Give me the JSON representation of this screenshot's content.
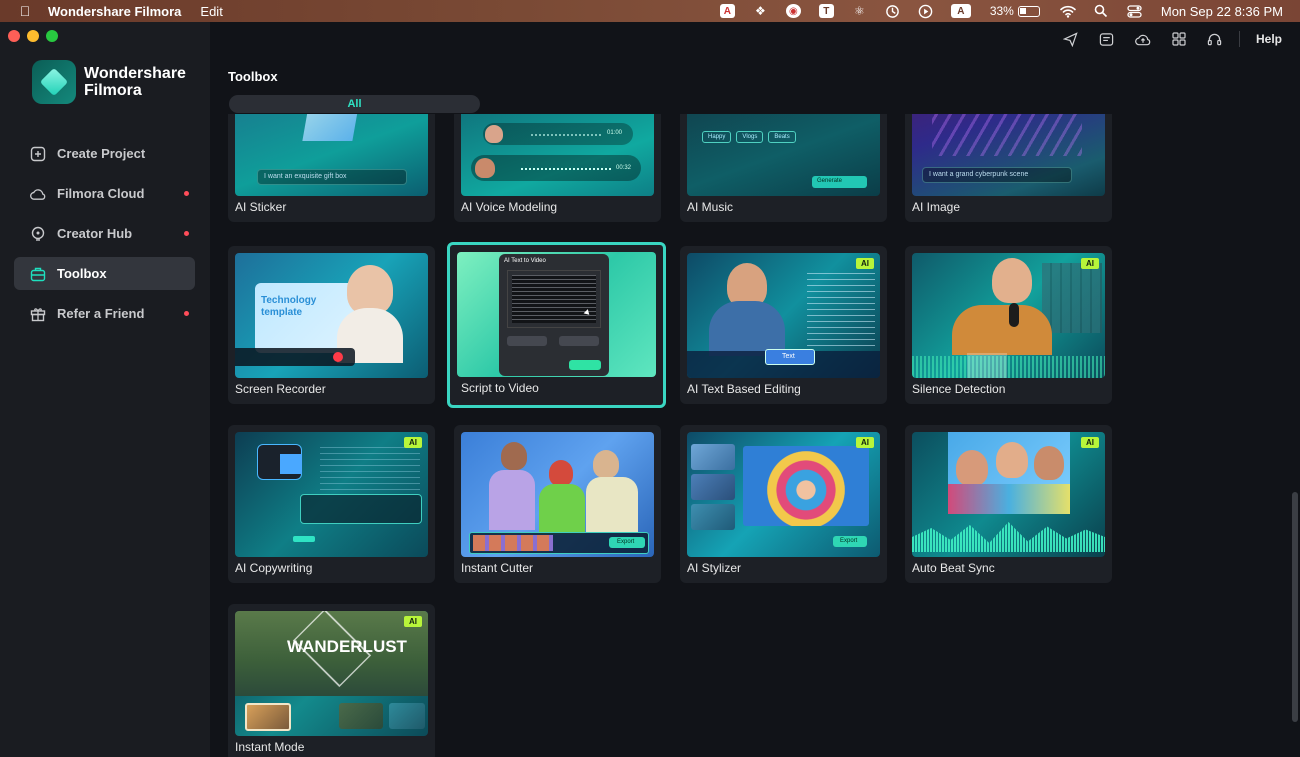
{
  "menubar": {
    "app_name": "Wondershare Filmora",
    "menus": [
      "Edit"
    ],
    "battery": "33%",
    "datetime": "Mon Sep 22  8:36 PM",
    "status_icons": [
      "adobe-icon",
      "dropbox-icon",
      "shield-icon",
      "text-icon",
      "pdf-icon",
      "time-machine-icon",
      "play-icon",
      "input-source-icon",
      "battery-icon",
      "wifi-icon",
      "search-icon",
      "control-center-icon"
    ],
    "input_source": "A",
    "text_icon_letter": "T"
  },
  "brand": {
    "line1": "Wondershare",
    "line2": "Filmora"
  },
  "nav": {
    "create_project": "Create Project",
    "filmora_cloud": "Filmora Cloud",
    "creator_hub": "Creator Hub",
    "toolbox": "Toolbox",
    "refer_friend": "Refer a Friend"
  },
  "topbar": {
    "help": "Help"
  },
  "main": {
    "title": "Toolbox",
    "filter_all": "All",
    "ai_badge": "AI",
    "cards": {
      "ai_sticker": "AI Sticker",
      "ai_voice_modeling": "AI Voice Modeling",
      "ai_music": "AI Music",
      "ai_image": "AI Image",
      "screen_recorder": "Screen Recorder",
      "script_to_video": "Script to Video",
      "ai_text_based_editing": "AI Text Based Editing",
      "silence_detection": "Silence Detection",
      "ai_copywriting": "AI Copywriting",
      "instant_cutter": "Instant Cutter",
      "ai_stylizer": "AI Stylizer",
      "auto_beat_sync": "Auto Beat Sync",
      "instant_mode": "Instant Mode"
    },
    "thumb_text": {
      "sticker_prompt": "I want an exquisite gift box",
      "image_prompt": "I want a grand cyberpunk scene",
      "music_tags": [
        "Happy",
        "Vlogs",
        "Beats"
      ],
      "music_generate": "Generate",
      "voice_time1": "01:00",
      "voice_time2": "00:32",
      "recorder_title": "Technology template",
      "script_title": "AI Text to Video",
      "text_edit_chip": "Text",
      "cutter_export": "Export",
      "stylizer_export": "Export",
      "wanderlust": "WANDERLUST"
    }
  },
  "colors": {
    "accent": "#2fe3c4",
    "ai_badge": "#b8f53a",
    "notify_dot": "#ff4d5a"
  }
}
